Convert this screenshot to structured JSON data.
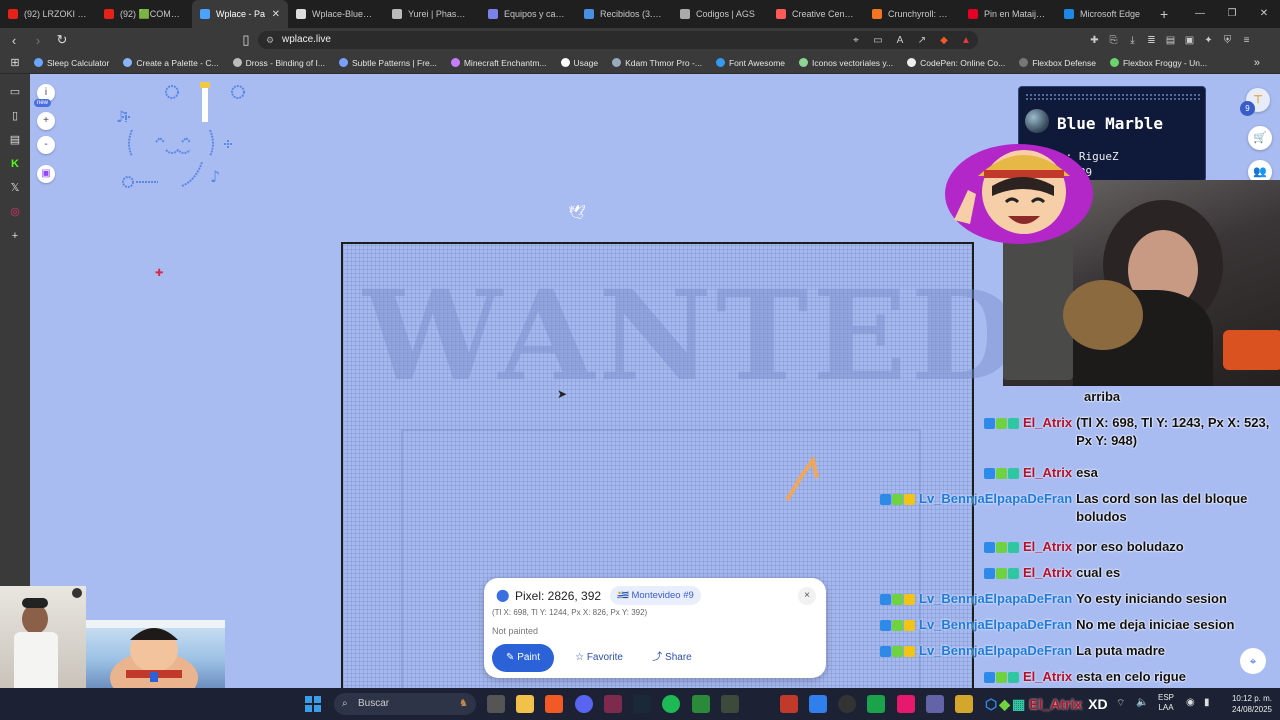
{
  "tabs": [
    {
      "title": "(92) LRZOKI - You",
      "color": "#e62117"
    },
    {
      "title": "(92) 🟩COMO PC",
      "color": "#e62117"
    },
    {
      "title": "Wplace - Pa",
      "color": "#4aa3ff",
      "active": true
    },
    {
      "title": "Wplace-BlueMarb",
      "color": "#dddddd"
    },
    {
      "title": "Yurei | Phasmoph",
      "color": "#bbbbbb"
    },
    {
      "title": "Equipos y canales",
      "color": "#7b83eb"
    },
    {
      "title": "Recibidos (3.874)",
      "color": "#4a90e2"
    },
    {
      "title": "Codigos | AGS",
      "color": "#aaaaaa"
    },
    {
      "title": "Creative Center: c",
      "color": "#ff5a5a"
    },
    {
      "title": "Crunchyroll: Wat",
      "color": "#f47521"
    },
    {
      "title": "Pin en Mataija id",
      "color": "#e60023"
    },
    {
      "title": "Microsoft Edge",
      "color": "#1e88e5"
    }
  ],
  "address": {
    "url": "wplace.live"
  },
  "bookmarks": [
    {
      "label": "Sleep Calculator",
      "color": "#6aa6ff"
    },
    {
      "label": "Create a Palette - C...",
      "color": "#8ab4f8"
    },
    {
      "label": "Dross - Binding of I...",
      "color": "#bbbbbb"
    },
    {
      "label": "Subtle Patterns | Fre...",
      "color": "#7aa0ff"
    },
    {
      "label": "Minecraft Enchantm...",
      "color": "#c77dff"
    },
    {
      "label": "Usage",
      "color": "#ffffff"
    },
    {
      "label": "Kdam Thmor Pro -...",
      "color": "#9ab"
    },
    {
      "label": "Font Awesome",
      "color": "#339af0"
    },
    {
      "label": "Iconos vectoriales y...",
      "color": "#8fd694"
    },
    {
      "label": "CodePen: Online Co...",
      "color": "#eeeeee"
    },
    {
      "label": "Flexbox Defense",
      "color": "#777777"
    },
    {
      "label": "Flexbox Froggy - Un...",
      "color": "#6cd36c"
    }
  ],
  "canvas": {
    "info_label": "i",
    "new_badge": "new",
    "zoom_in": "+",
    "zoom_out": "-"
  },
  "pixel_card": {
    "title": "Pixel: 2826, 392",
    "region": "🇺🇾 Montevideo #9",
    "coords": "(Tl X: 698, Tl Y: 1244, Px X: 826, Px Y: 392)",
    "status": "Not painted",
    "paint_label": "Paint",
    "favorite_label": "Favorite",
    "share_label": "Share",
    "close": "×"
  },
  "blue_marble": {
    "title": "Blue Marble",
    "user": "e: RigueZ",
    "number": ": 789",
    "level_badge": "9"
  },
  "poster": {
    "wanted": "WANTED"
  },
  "chat": [
    {
      "user": "",
      "text": "arriba",
      "kind": "none"
    },
    {
      "user": "El_Atrix",
      "text": "(Tl X: 698, Tl Y: 1243, Px X: 523, Px Y: 948)",
      "kind": "atrix"
    },
    {
      "user": "El_Atrix",
      "text": "esa",
      "kind": "atrix"
    },
    {
      "user": "Lv_BennjaElpapaDeFran",
      "text": "Las cord son las del bloque boludos",
      "kind": "benn"
    },
    {
      "user": "El_Atrix",
      "text": "por eso boludazo",
      "kind": "atrix"
    },
    {
      "user": "El_Atrix",
      "text": "cual es",
      "kind": "atrix"
    },
    {
      "user": "Lv_BennjaElpapaDeFran",
      "text": "Yo esty iniciando sesion",
      "kind": "benn"
    },
    {
      "user": "Lv_BennjaElpapaDeFran",
      "text": "No me deja iniciae sesion",
      "kind": "benn"
    },
    {
      "user": "Lv_BennjaElpapaDeFran",
      "text": "La puta madre",
      "kind": "benn"
    },
    {
      "user": "El_Atrix",
      "text": "esta en celo rigue",
      "kind": "atrix"
    }
  ],
  "taskbar": {
    "search_label": "Buscar",
    "overlay_user": "El_Atrix",
    "overlay_text": "XD",
    "lang_top": "ESP",
    "lang_bottom": "LAA",
    "time": "10:12 p. m.",
    "date": "24/08/2025"
  }
}
